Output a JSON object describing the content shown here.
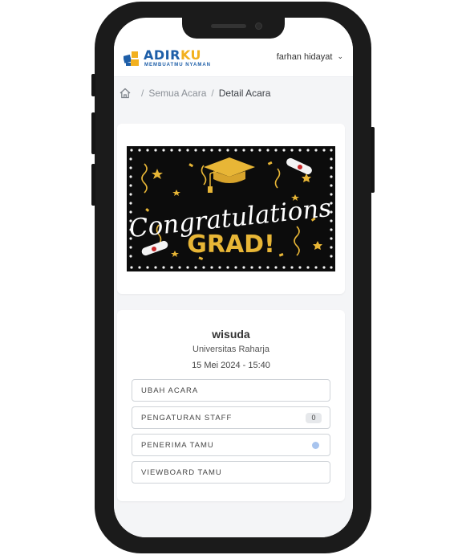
{
  "header": {
    "logo_text_blue": "ADIR",
    "logo_text_yellow": "KU",
    "logo_tagline": "MEMBUATMU NYAMAN",
    "user_name": "farhan hidayat"
  },
  "breadcrumb": {
    "items": [
      "Semua Acara",
      "Detail Acara"
    ],
    "separator": "/"
  },
  "banner": {
    "script_text": "Congratulations",
    "big_text": "GRAD!"
  },
  "event": {
    "title": "wisuda",
    "location": "Universitas Raharja",
    "datetime": "15 Mei 2024 - 15:40"
  },
  "menu": {
    "edit_label": "UBAH ACARA",
    "staff_label": "PENGATURAN STAFF",
    "staff_count": "0",
    "receptionist_label": "PENERIMA TAMU",
    "viewboard_label": "VIEWBOARD TAMU"
  },
  "colors": {
    "brand_blue": "#1d5ea8",
    "brand_yellow": "#f2b01e",
    "gold": "#e8b636",
    "status_dot": "#a8c4ee"
  }
}
